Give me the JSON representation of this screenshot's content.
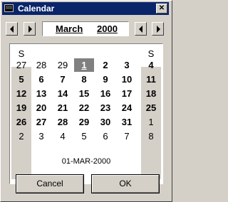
{
  "window": {
    "title": "Calendar",
    "close_glyph": "✕"
  },
  "nav": {
    "month": "March",
    "year": "2000"
  },
  "calendar": {
    "weekday_headers": [
      "S",
      "",
      "",
      "",
      "",
      "",
      "S"
    ],
    "weeks": [
      [
        "27",
        "28",
        "29",
        "1",
        "2",
        "3",
        "4"
      ],
      [
        "5",
        "6",
        "7",
        "8",
        "9",
        "10",
        "11"
      ],
      [
        "12",
        "13",
        "14",
        "15",
        "16",
        "17",
        "18"
      ],
      [
        "19",
        "20",
        "21",
        "22",
        "23",
        "24",
        "25"
      ],
      [
        "26",
        "27",
        "28",
        "29",
        "30",
        "31",
        "1"
      ],
      [
        "2",
        "3",
        "4",
        "5",
        "6",
        "7",
        "8"
      ]
    ],
    "selected_day": "1"
  },
  "selected_date_text": "01-MAR-2000",
  "buttons": {
    "cancel": "Cancel",
    "ok": "OK"
  },
  "colors": {
    "titlebar": "#0a246a",
    "face": "#d4d0c8",
    "selected": "#808080"
  }
}
